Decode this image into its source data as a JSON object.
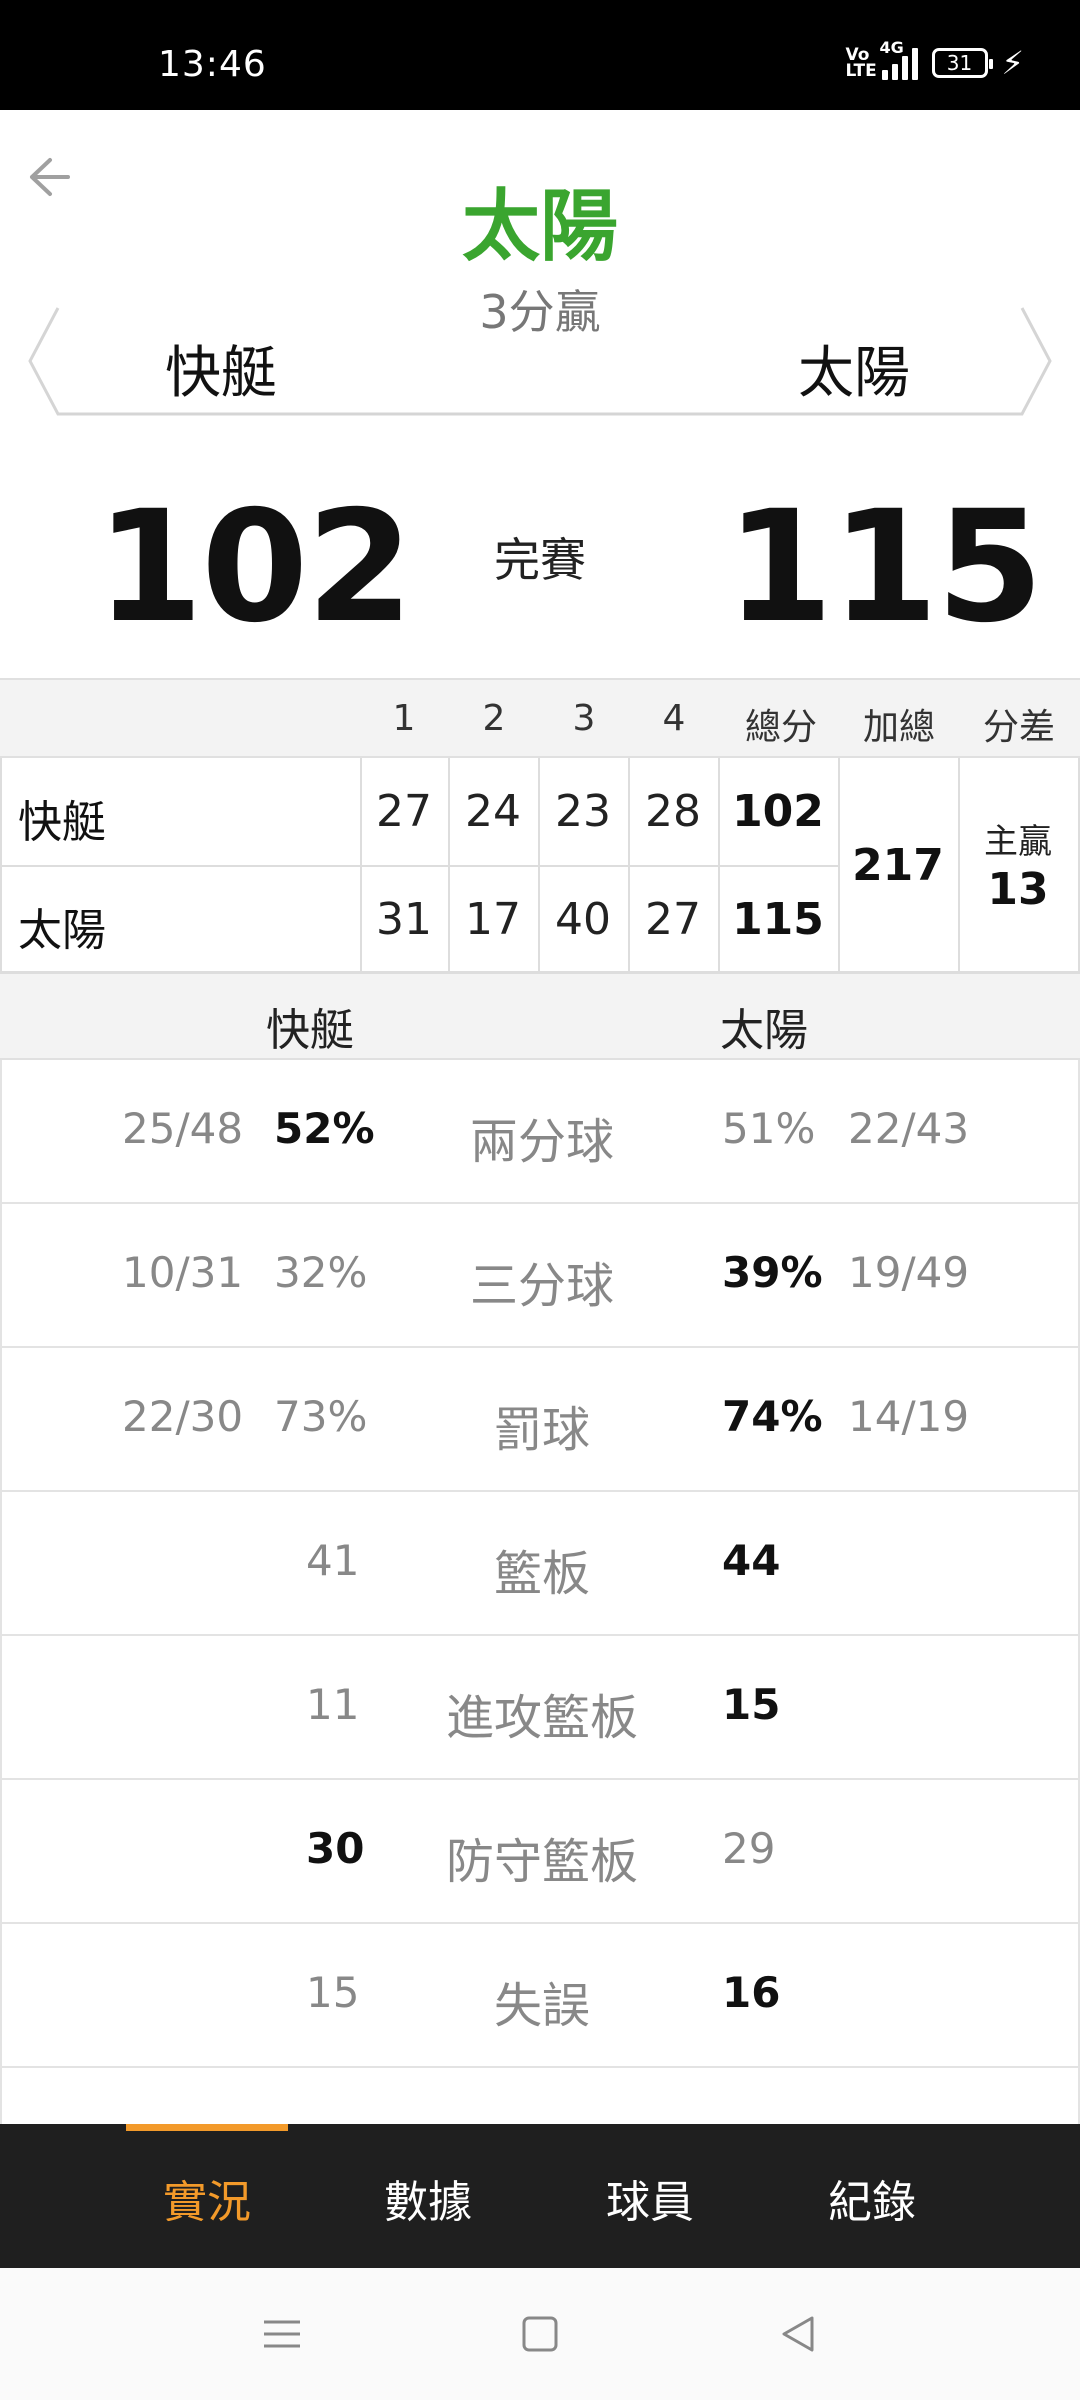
{
  "status_bar": {
    "time": "13:46",
    "volte": "Vo LTE",
    "network": "4G",
    "battery": "31"
  },
  "header": {
    "winner": "太陽",
    "margin_text": "3分贏",
    "home_team": "快艇",
    "away_team": "太陽",
    "home_score": "102",
    "away_score": "115",
    "status": "完賽"
  },
  "quarter_table": {
    "headers": [
      "1",
      "2",
      "3",
      "4",
      "總分",
      "加總",
      "分差"
    ],
    "rows": [
      {
        "team": "快艇",
        "q": [
          "27",
          "24",
          "23",
          "28"
        ],
        "total": "102"
      },
      {
        "team": "太陽",
        "q": [
          "31",
          "17",
          "40",
          "27"
        ],
        "total": "115"
      }
    ],
    "sum": "217",
    "diff_label": "主贏",
    "diff_value": "13"
  },
  "stats": {
    "home_label": "快艇",
    "away_label": "太陽",
    "rows": [
      {
        "label": "兩分球",
        "home_made": "25/48",
        "home_pct": "52%",
        "away_pct": "51%",
        "away_made": "22/43"
      },
      {
        "label": "三分球",
        "home_made": "10/31",
        "home_pct": "32%",
        "away_pct": "39%",
        "away_made": "19/49"
      },
      {
        "label": "罰球",
        "home_made": "22/30",
        "home_pct": "73%",
        "away_pct": "74%",
        "away_made": "14/19"
      },
      {
        "label": "籃板",
        "home_val": "41",
        "away_val": "44"
      },
      {
        "label": "進攻籃板",
        "home_val": "11",
        "away_val": "15"
      },
      {
        "label": "防守籃板",
        "home_val": "30",
        "away_val": "29"
      },
      {
        "label": "失誤",
        "home_val": "15",
        "away_val": "16"
      }
    ]
  },
  "tabs": [
    "實況",
    "數據",
    "球員",
    "紀錄"
  ],
  "colors": {
    "win_green": "#3aa52f",
    "accent_orange": "#f39a2a",
    "tabbar_bg": "#1f1f1f"
  }
}
